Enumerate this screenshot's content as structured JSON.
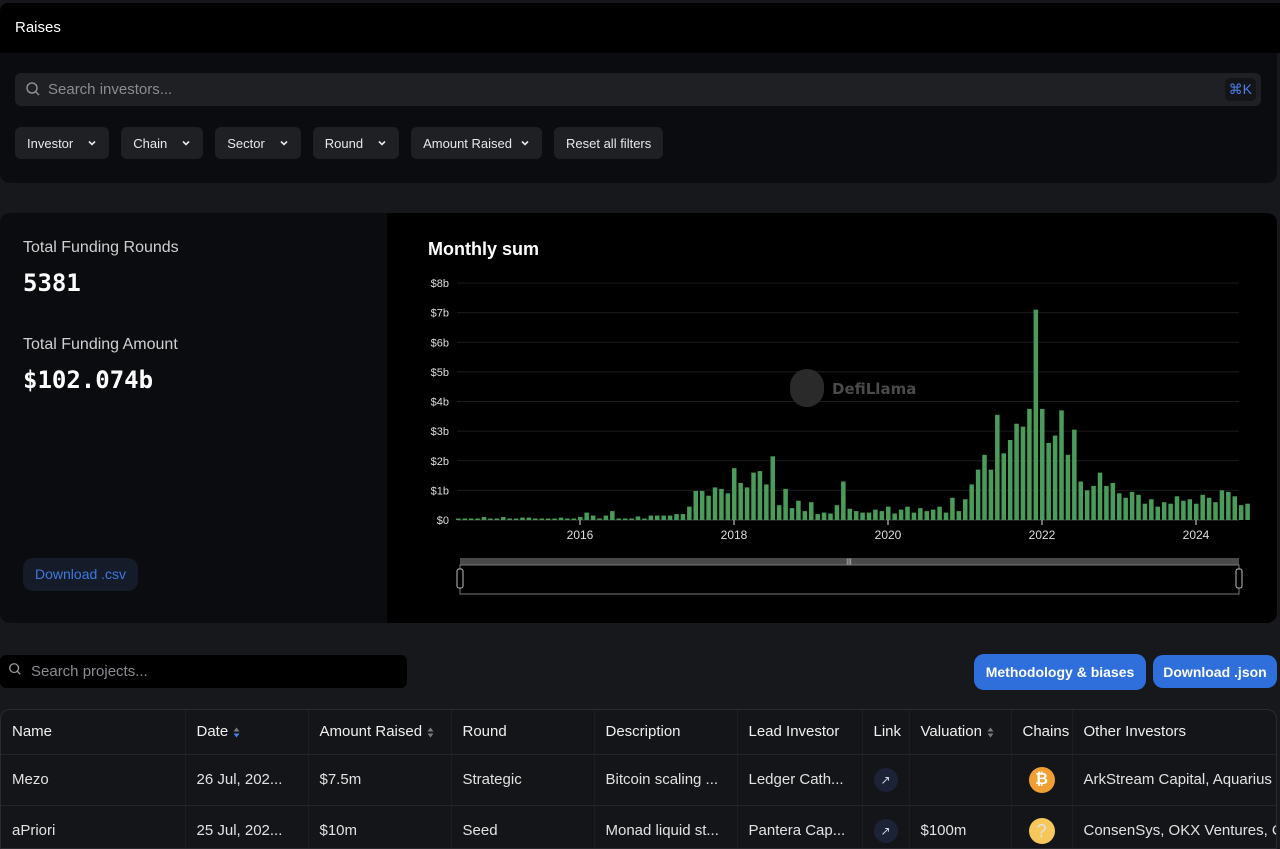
{
  "header": {
    "title": "Raises"
  },
  "filters": {
    "search_placeholder": "Search investors...",
    "shortcut": "⌘K",
    "buttons": [
      "Investor",
      "Chain",
      "Sector",
      "Round",
      "Amount Raised"
    ],
    "reset_label": "Reset all filters"
  },
  "stats": {
    "rounds_label": "Total Funding Rounds",
    "rounds_value": "5381",
    "amount_label": "Total Funding Amount",
    "amount_value": "$102.074b",
    "download_csv": "Download .csv"
  },
  "chart_data": {
    "type": "bar",
    "title": "Monthly sum",
    "xlabel": "",
    "ylabel": "",
    "ylim": [
      0,
      8
    ],
    "y_unit": "billions USD",
    "y_ticks": [
      "$0",
      "$1b",
      "$2b",
      "$3b",
      "$4b",
      "$5b",
      "$6b",
      "$7b",
      "$8b"
    ],
    "x_ticks": [
      "2016",
      "2018",
      "2020",
      "2022",
      "2024"
    ],
    "x_tick_values": [
      2016.0,
      2018.0,
      2020.0,
      2022.0,
      2024.0
    ],
    "x_start": 2014.42,
    "x_step_months": 1,
    "color": "#4a9c5a",
    "grid": true,
    "legend": "none",
    "watermark": "DefiLlama",
    "values": [
      0.05,
      0.05,
      0.03,
      0.05,
      0.1,
      0.05,
      0.05,
      0.1,
      0.05,
      0.03,
      0.08,
      0.08,
      0.03,
      0.02,
      0.03,
      0.05,
      0.08,
      0.03,
      0.03,
      0.1,
      0.25,
      0.15,
      0.05,
      0.15,
      0.3,
      0.05,
      0.05,
      0.03,
      0.12,
      0.03,
      0.15,
      0.15,
      0.15,
      0.15,
      0.2,
      0.2,
      0.45,
      0.98,
      0.98,
      0.82,
      1.1,
      1.05,
      0.9,
      1.75,
      1.25,
      1.1,
      1.6,
      1.65,
      1.2,
      2.15,
      0.5,
      1.05,
      0.4,
      0.65,
      0.3,
      0.6,
      0.2,
      0.25,
      0.22,
      0.5,
      1.3,
      0.38,
      0.3,
      0.25,
      0.25,
      0.35,
      0.3,
      0.45,
      0.22,
      0.35,
      0.45,
      0.25,
      0.4,
      0.3,
      0.35,
      0.45,
      0.25,
      0.75,
      0.3,
      0.7,
      1.2,
      1.7,
      2.2,
      1.7,
      3.55,
      2.25,
      2.7,
      3.25,
      3.15,
      3.75,
      7.1,
      3.75,
      2.6,
      2.85,
      3.7,
      2.2,
      3.05,
      1.3,
      1.0,
      1.15,
      1.6,
      1.15,
      1.25,
      0.9,
      0.75,
      0.95,
      0.85,
      0.55,
      0.7,
      0.45,
      0.6,
      0.55,
      0.8,
      0.65,
      0.7,
      0.55,
      0.85,
      0.75,
      0.6,
      1.0,
      0.95,
      0.8,
      0.5,
      0.55
    ],
    "range_selector": {
      "start_fraction": 0.0,
      "end_fraction": 1.0
    }
  },
  "table_controls": {
    "search_placeholder": "Search projects...",
    "methodology_label": "Methodology & biases",
    "download_json_label": "Download .json"
  },
  "table": {
    "columns": [
      "Name",
      "Date",
      "Amount Raised",
      "Round",
      "Description",
      "Lead Investor",
      "Link",
      "Valuation",
      "Chains",
      "Other Investors"
    ],
    "rows": [
      {
        "name": "Mezo",
        "date": "26 Jul, 202...",
        "amount": "$7.5m",
        "round": "Strategic",
        "description": "Bitcoin scaling ...",
        "lead": "Ledger Cath...",
        "link": "↗",
        "valuation": "",
        "chain": "bitcoin-icon",
        "others": "ArkStream Capital, Aquarius"
      },
      {
        "name": "aPriori",
        "date": "25 Jul, 202...",
        "amount": "$10m",
        "round": "Seed",
        "description": "Monad liquid st...",
        "lead": "Pantera Cap...",
        "link": "↗",
        "valuation": "$100m",
        "chain": "unknown-chain-icon",
        "others": "ConsenSys, OKX Ventures, C"
      }
    ]
  },
  "colors": {
    "accent": "#2f6fdc",
    "bar": "#4a9c5a",
    "kbd": "#4b7fe8"
  }
}
